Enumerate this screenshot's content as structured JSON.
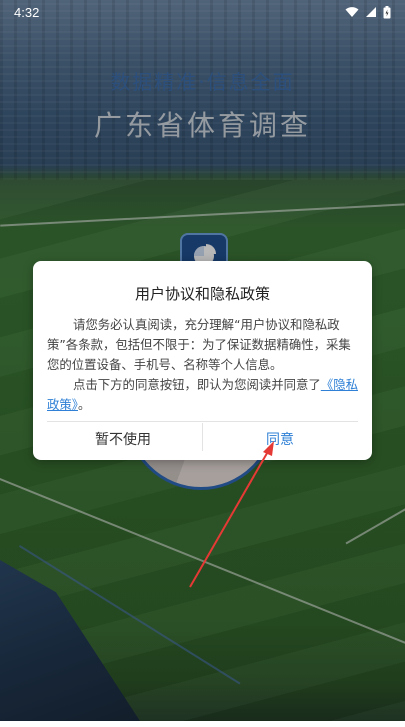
{
  "status_bar": {
    "time": "4:32",
    "icons": [
      "wifi-icon",
      "cellular-icon",
      "battery-icon"
    ]
  },
  "splash": {
    "tagline": "数据精准·信息全面",
    "title": "广东省体育调查"
  },
  "dialog": {
    "title": "用户协议和隐私政策",
    "para1": "请您务必认真阅读，充分理解“用户协议和隐私政策”各条款，包括但不限于：为了保证数据精确性，采集您的位置设备、手机号、名称等个人信息。",
    "para2_prefix": "点击下方的同意按钮，即认为您阅读并同意了",
    "privacy_link": "《隐私政策》",
    "para2_suffix": "。",
    "decline_label": "暂不使用",
    "agree_label": "同意"
  },
  "colors": {
    "accent": "#2f80d6",
    "annotation_arrow": "#e53935"
  }
}
